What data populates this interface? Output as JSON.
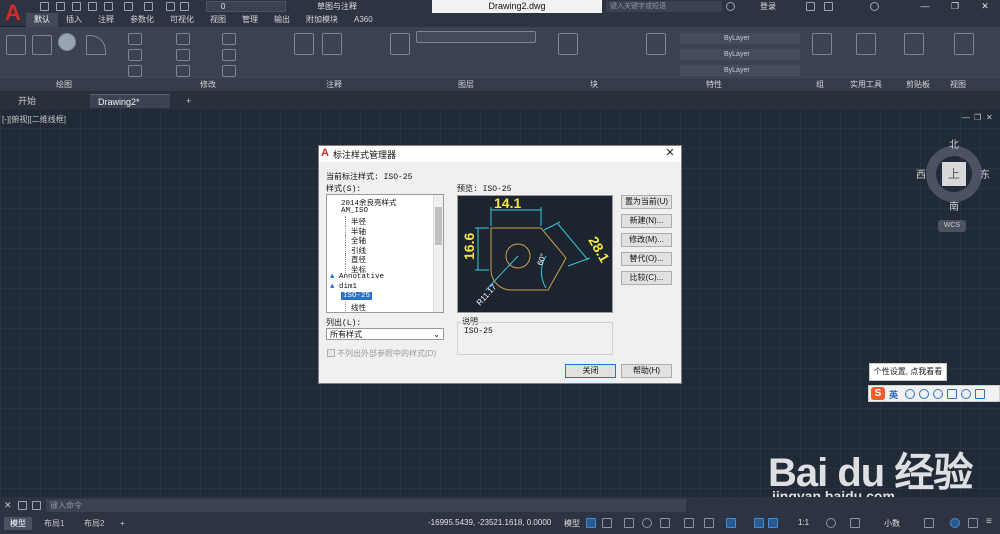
{
  "titlebar": {
    "layer_value": "0",
    "workspace": "草图与注释",
    "document_title": "Drawing2.dwg",
    "search_placeholder": "键入关键字或短语",
    "signin": "登录"
  },
  "ribbon_tabs": [
    "默认",
    "插入",
    "注释",
    "参数化",
    "可视化",
    "视图",
    "管理",
    "输出",
    "附加模块",
    "A360"
  ],
  "ribbon_groups": [
    "绘图",
    "修改",
    "注释",
    "图层",
    "块",
    "特性",
    "组",
    "实用工具",
    "剪贴板",
    "视图"
  ],
  "ribbon_properties": [
    "ByLayer",
    "ByLayer",
    "ByLayer"
  ],
  "file_tabs": [
    "开始",
    "Drawing2*"
  ],
  "viewport_label": "[-][俯视][二维线框]",
  "viewcube": {
    "face": "上",
    "north": "北",
    "south": "南",
    "east": "东",
    "west": "西",
    "ucs": "WCS"
  },
  "dialog": {
    "title": "标注样式管理器",
    "current_style_label": "当前标注样式: ISO-25",
    "styles_label": "样式(S):",
    "styles": [
      {
        "label": "2014余良亮样式",
        "indent": 1
      },
      {
        "label": "AM_ISO",
        "indent": 1
      },
      {
        "label": "半径",
        "indent": 2
      },
      {
        "label": "半轴",
        "indent": 2
      },
      {
        "label": "全轴",
        "indent": 2
      },
      {
        "label": "引线",
        "indent": 2
      },
      {
        "label": "直径",
        "indent": 2
      },
      {
        "label": "坐标",
        "indent": 2
      },
      {
        "label": "Annotative",
        "indent": 0,
        "annotative": true
      },
      {
        "label": "dim1",
        "indent": 0,
        "annotative": true
      },
      {
        "label": "ISO-25",
        "indent": 1,
        "selected": true
      },
      {
        "label": "线性",
        "indent": 2
      }
    ],
    "list_label": "列出(L):",
    "list_value": "所有样式",
    "exclude_xref_label": "不列出外部参照中的样式(D)",
    "preview_label": "预览: ISO-25",
    "preview_dims": {
      "top": "14.1",
      "left": "16.6",
      "diagonal": "28.1",
      "angle": "60°",
      "radius": "R11.17"
    },
    "description_label": "说明",
    "description_value": "ISO-25",
    "buttons": {
      "set_current": "置为当前(U)",
      "new": "新建(N)...",
      "modify": "修改(M)...",
      "override": "替代(O)...",
      "compare": "比较(C)...",
      "close": "关闭",
      "help": "帮助(H)"
    }
  },
  "ime": {
    "tooltip": "个性设置, 点我看看",
    "language": "英"
  },
  "watermark": {
    "text": "Bai du 经验",
    "url": "jingyan.baidu.com"
  },
  "command": {
    "placeholder": "键入命令"
  },
  "statusbar": {
    "layout_tabs": [
      "模型",
      "布局1",
      "布局2"
    ],
    "coordinates": "-16995.5439, -23521.1618, 0.0000",
    "model": "模型",
    "scale": "1:1",
    "units": "小数"
  },
  "colors": {
    "accent": "#2a72c9",
    "logo": "#d32a2a",
    "canvas": "#212a37",
    "preview_text": "#f5e642",
    "preview_dim": "#37c7d8"
  }
}
